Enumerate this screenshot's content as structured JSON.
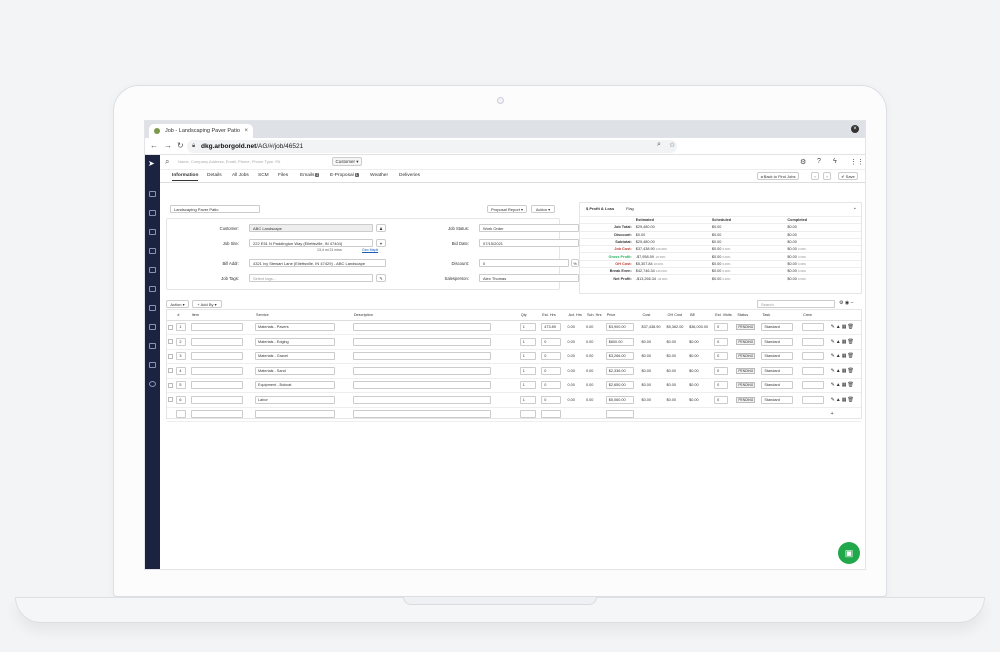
{
  "browser": {
    "tab_title": "Job - Landscaping Paver Patio",
    "tab_close": "×",
    "url_host": "dkg.arborgold.net",
    "url_path": "/AG/#/job/46521",
    "window_close": "×"
  },
  "topnav": {
    "search_placeholder": "Name, Company Address, Email, Phone, Phone Type, PA",
    "customer_filter": "Customer ▾"
  },
  "job_tabs": [
    {
      "label": "Information",
      "active": true
    },
    {
      "label": "Details"
    },
    {
      "label": "All Jobs"
    },
    {
      "label": "SCM"
    },
    {
      "label": "Files"
    },
    {
      "label": "Emails",
      "badge": "2"
    },
    {
      "label": "E-Proposal",
      "badge": "1"
    },
    {
      "label": "Weather"
    },
    {
      "label": "Deliveries"
    }
  ],
  "right_actions": {
    "back": "◂ Back to Find Jobs",
    "save": "✔ Save"
  },
  "info": {
    "job_name": "Landscaping Paver Patio",
    "proposal_report": "Proposal Report ▾",
    "action": "Action ▾",
    "customer_label": "Customer:",
    "customer_value": "ABC Landscape",
    "jobsite_label": "Job Site:",
    "jobsite_value": "222 E51 N Paddington Way (Ellettsville, IN 47404)",
    "jobsite_sub": "13.4 mi 21 mins",
    "jobsite_link": "Geo Mapit",
    "billaddr_label": "Bill Addr:",
    "billaddr_value": "4321 Ivy Stewart Lane (Ellettsville, IN 47429) - ABC Landscape",
    "jobtags_label": "Job Tags:",
    "jobtags_placeholder": "Select tags...",
    "jobstatus_label": "Job Status:",
    "jobstatus_value": "Work Order",
    "biddate_label": "Bid Date:",
    "biddate_value": "07/15/2021",
    "discount_label": "Discount:",
    "discount_value": "0",
    "discount_unit": "%",
    "salesperson_label": "Salesperson:",
    "salesperson_value": "Alex Thomas"
  },
  "profit": {
    "tabs": [
      "$ Profit & Loss",
      "Flag"
    ],
    "headers": [
      "",
      "Estimated",
      "Scheduled",
      "Completed"
    ],
    "rows": [
      {
        "k": "Job Total:",
        "e": "$29,480.00",
        "s": "$0.00",
        "c": "$0.00"
      },
      {
        "k": "Discount:",
        "e": "$0.00",
        "s": "$0.00",
        "c": "$0.00"
      },
      {
        "k": "Subtotal:",
        "e": "$29,480.00",
        "s": "$0.00",
        "c": "$0.00"
      },
      {
        "k": "Job Cost:",
        "e": "$37,438.90",
        "ep": "126.99%",
        "s": "$0.00",
        "sp": "0.00%",
        "c": "$0.00",
        "cp": "0.00%",
        "cls": "neg"
      },
      {
        "k": "Gross Profit:",
        "e": "-$7,958.59",
        "ep": "-26.99%",
        "s": "$0.00",
        "sp": "0.00%",
        "c": "$0.00",
        "cp": "0.00%",
        "cls": "gr"
      },
      {
        "k": "OH Cost:",
        "e": "$5,307.84",
        "ep": "18.00%",
        "s": "$0.00",
        "sp": "0.00%",
        "c": "$0.00",
        "cp": "0.00%",
        "cls": "neg"
      },
      {
        "k": "Break Even:",
        "e": "$42,746.34",
        "ep": "145.00%",
        "s": "$0.00",
        "sp": "0.00%",
        "c": "$0.00",
        "cp": "0.00%"
      },
      {
        "k": "Net Profit:",
        "e": "-$13,266.34",
        "ep": "-45.00%",
        "s": "$0.00",
        "sp": "0.00%",
        "c": "$0.00",
        "cp": "0.00%"
      }
    ]
  },
  "grid": {
    "action": "Action ▾",
    "addby": "+ Add By ▾",
    "search_placeholder": "Search",
    "headers": [
      "",
      "#",
      "Item",
      "Service",
      "Description",
      "Qty",
      "Est. Hrs",
      "Act. Hrs",
      "Sch. Hrs",
      "Price",
      "Cost",
      "OH Cost",
      "BE",
      "Est. Visits",
      "Status",
      "Task",
      "Crew",
      ""
    ],
    "rows": [
      {
        "n": "1",
        "service": "Materials - Pavers",
        "qty": "1",
        "est": "473.89",
        "act": "0.00",
        "sch": "0.00",
        "price": "$3,900.00",
        "cost": "$37,438.90",
        "oh": "$5,362.00",
        "be": "$36,000.00",
        "visits": "0",
        "status": "PENDING",
        "task": "Standard"
      },
      {
        "n": "2",
        "service": "Materials - Edging",
        "qty": "1",
        "est": "0",
        "act": "0.00",
        "sch": "0.00",
        "price": "$600.00",
        "cost": "$0.00",
        "oh": "$0.00",
        "be": "$0.00",
        "visits": "0",
        "status": "PENDING",
        "task": "Standard"
      },
      {
        "n": "3",
        "service": "Materials - Gravel",
        "qty": "1",
        "est": "0",
        "act": "0.00",
        "sch": "0.00",
        "price": "$3,266.00",
        "cost": "$0.00",
        "oh": "$0.00",
        "be": "$0.00",
        "visits": "0",
        "status": "PENDING",
        "task": "Standard"
      },
      {
        "n": "4",
        "service": "Materials - Sand",
        "qty": "1",
        "est": "0",
        "act": "0.00",
        "sch": "0.00",
        "price": "$2,336.00",
        "cost": "$0.00",
        "oh": "$0.00",
        "be": "$0.00",
        "visits": "0",
        "status": "PENDING",
        "task": "Standard"
      },
      {
        "n": "5",
        "service": "Equipment - Bobcat",
        "qty": "1",
        "est": "0",
        "act": "0.00",
        "sch": "0.00",
        "price": "$2,650.00",
        "cost": "$0.00",
        "oh": "$0.00",
        "be": "$0.00",
        "visits": "0",
        "status": "PENDING",
        "task": "Standard"
      },
      {
        "n": "6",
        "service": "Labor",
        "qty": "1",
        "est": "0",
        "act": "0.00",
        "sch": "0.00",
        "price": "$5,060.00",
        "cost": "$0.00",
        "oh": "$0.00",
        "be": "$0.00",
        "visits": "0",
        "status": "PENDING",
        "task": "Standard"
      }
    ]
  },
  "chat_icon": "chat-bubble-icon"
}
